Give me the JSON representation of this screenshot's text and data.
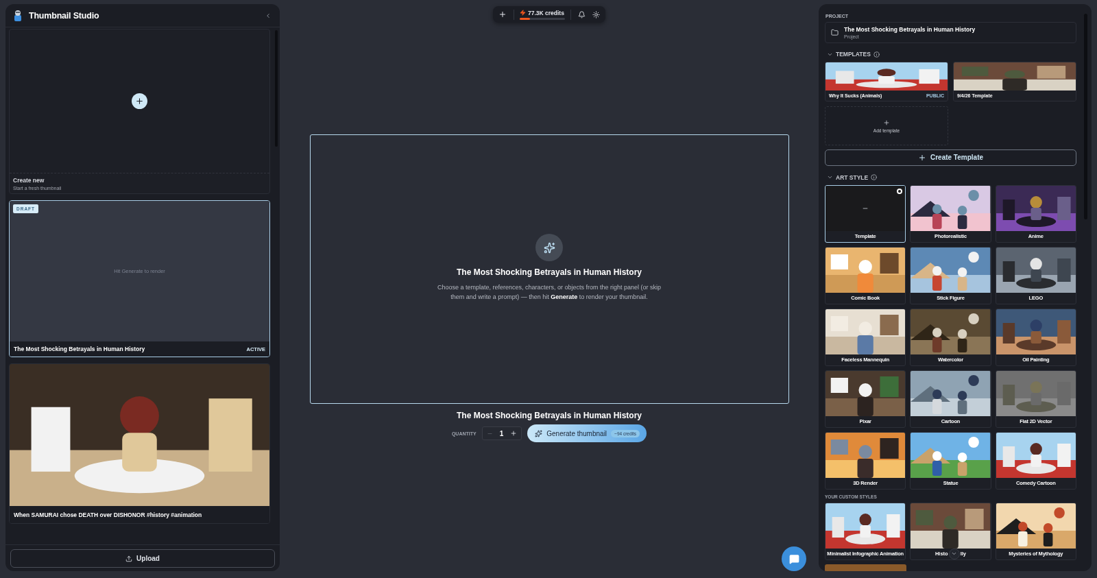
{
  "sidebar": {
    "title": "Thumbnail Studio",
    "items": [
      {
        "kind": "create",
        "title": "Create new",
        "subtitle": "Start a fresh thumbnail",
        "selected": false
      },
      {
        "kind": "draft",
        "badge": "DRAFT",
        "placeholder": "Hit Generate to render",
        "title": "The Most Shocking Betrayals in Human History",
        "status": "ACTIVE",
        "selected": true
      },
      {
        "kind": "video",
        "title": "When SAMURAI chose DEATH over DISHONOR #history #animation",
        "selected": false
      }
    ],
    "upload_button": "Upload"
  },
  "top_bar": {
    "credits": "77.3K credits",
    "level": 0.23
  },
  "canvas": {
    "title": "The Most Shocking Betrayals in Human History",
    "hint": "Choose a template, references, characters, or objects from the right panel (or skip them and write a prompt) — then hit **Generate** to render your thumbnail."
  },
  "generate": {
    "title": "The Most Shocking Betrayals in Human History",
    "quantity_label": "QUANTITY",
    "quantity": "1",
    "decrement_disabled": true,
    "button": "Generate thumbnail",
    "cost": "~94 credits"
  },
  "right_panel": {
    "project_label": "PROJECT",
    "project": {
      "name": "The Most Shocking Betrayals in Human History",
      "type": "Project"
    },
    "templates": {
      "heading": "TEMPLATES",
      "expanded": true,
      "items": [
        {
          "name": "Why It Sucks (Animals)",
          "badge": "PUBLIC"
        },
        {
          "name": "9/4/26 Template"
        }
      ],
      "add_label": "Add template",
      "create_button": "Create Template"
    },
    "art_style": {
      "heading": "ART STYLE",
      "expanded": true,
      "items": [
        {
          "label": "Template",
          "kind": "blank",
          "selected": true
        },
        {
          "label": "Photorealistic",
          "kind": "picture",
          "selected": false
        },
        {
          "label": "Anime",
          "kind": "picture",
          "selected": false
        },
        {
          "label": "Comic Book",
          "kind": "picture",
          "selected": false
        },
        {
          "label": "Stick Figure",
          "kind": "picture",
          "selected": false
        },
        {
          "label": "LEGO",
          "kind": "picture",
          "selected": false
        },
        {
          "label": "Faceless Mannequin",
          "kind": "picture",
          "selected": false
        },
        {
          "label": "Watercolor",
          "kind": "picture",
          "selected": false
        },
        {
          "label": "Oil Painting",
          "kind": "picture",
          "selected": false
        },
        {
          "label": "Pixar",
          "kind": "picture",
          "selected": false
        },
        {
          "label": "Cartoon",
          "kind": "picture",
          "selected": false
        },
        {
          "label": "Flat 2D Vector",
          "kind": "picture",
          "selected": false
        },
        {
          "label": "3D Render",
          "kind": "picture",
          "selected": false
        },
        {
          "label": "Statue",
          "kind": "picture",
          "selected": false
        },
        {
          "label": "Comedy Cartoon",
          "kind": "picture",
          "selected": false
        }
      ],
      "custom_heading": "YOUR CUSTOM STYLES",
      "custom_items": [
        {
          "label": "Minimalist Infographic Animation",
          "kind": "picture",
          "selected": false
        },
        {
          "label_start": "Histo",
          "label_end": "lly",
          "kind": "covered",
          "selected": false
        },
        {
          "label": "Mysteries of Mythology",
          "kind": "picture",
          "selected": false
        }
      ]
    }
  }
}
